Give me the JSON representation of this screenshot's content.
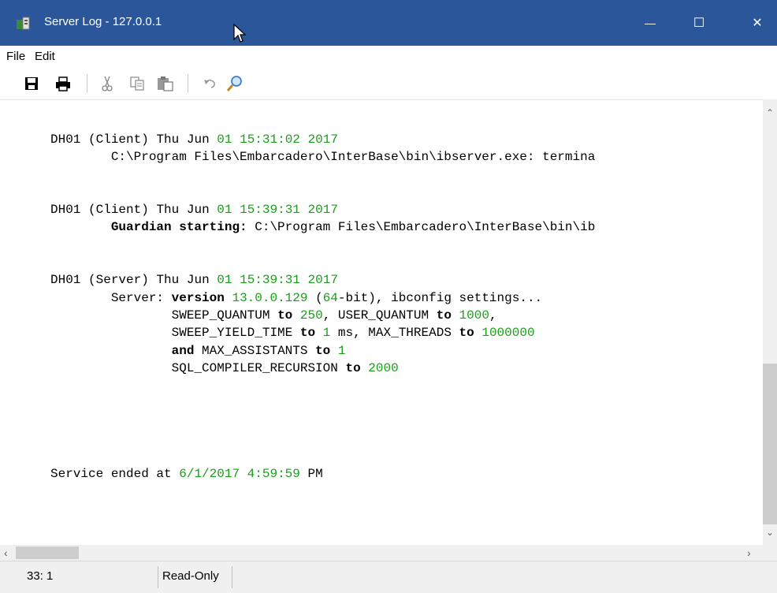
{
  "window": {
    "title": "Server Log - 127.0.0.1",
    "controls": {
      "minimize": "—",
      "maximize": "☐",
      "close": "✕"
    }
  },
  "menu": {
    "items": [
      "File",
      "Edit"
    ]
  },
  "toolbar": {
    "icons": [
      "save-icon",
      "print-icon",
      "cut-icon",
      "copy-icon",
      "paste-icon",
      "undo-icon",
      "find-icon"
    ]
  },
  "log": {
    "entries": [
      {
        "header": {
          "host": "DH01",
          "role": "(Client)",
          "day": "Thu",
          "month": "Jun",
          "date": "01",
          "time": "15:31:02",
          "year": "2017"
        },
        "message": "C:\\Program Files\\Embarcadero\\InterBase\\bin\\ibserver.exe: termina"
      },
      {
        "header": {
          "host": "DH01",
          "role": "(Client)",
          "day": "Thu",
          "month": "Jun",
          "date": "01",
          "time": "15:39:31",
          "year": "2017"
        },
        "message_keyword": "Guardian starting:",
        "message": " C:\\Program Files\\Embarcadero\\InterBase\\bin\\ib"
      },
      {
        "header": {
          "host": "DH01",
          "role": "(Server)",
          "day": "Thu",
          "month": "Jun",
          "date": "01",
          "time": "15:39:31",
          "year": "2017"
        },
        "server_prefix": "Server:",
        "server_version_kw": "version",
        "server_version": "13.0.0.129",
        "server_bits": "64",
        "server_suffix": "ibconfig settings...",
        "settings": {
          "sweep_quantum_name": "SWEEP_QUANTUM",
          "sweep_quantum": "250",
          "user_quantum_name": "USER_QUANTUM",
          "user_quantum": "1000",
          "sweep_yield_name": "SWEEP_YIELD_TIME",
          "sweep_yield": "1",
          "sweep_yield_unit": "ms",
          "max_threads_name": "MAX_THREADS",
          "max_threads": "1000000",
          "max_assistants_name": "MAX_ASSISTANTS",
          "max_assistants": "1",
          "sql_recursion_name": "SQL_COMPILER_RECURSION",
          "sql_recursion": "2000"
        }
      }
    ],
    "service_end": {
      "label": "Service ended at",
      "date": "6/1/2017",
      "time": "4:59:59",
      "ampm": "PM"
    }
  },
  "status": {
    "position": "33: 1",
    "mode": "Read-Only"
  }
}
